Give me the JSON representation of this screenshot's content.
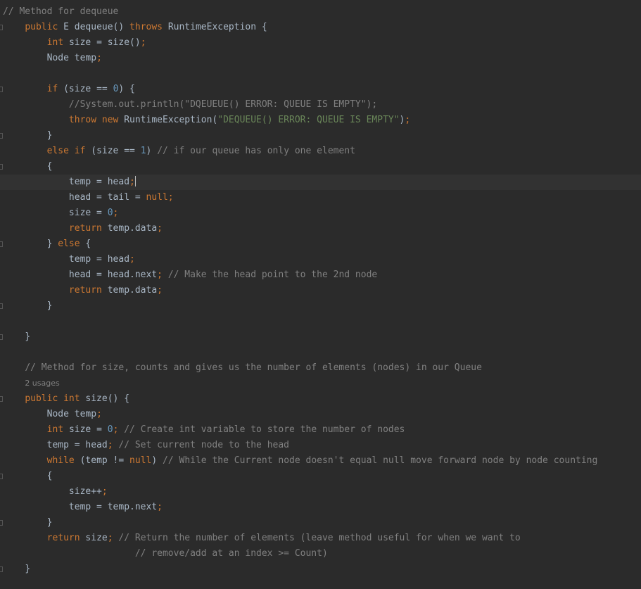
{
  "lines": [
    {
      "fold": false,
      "indent": "",
      "tokens": [
        [
          "cm",
          "// Method for dequeue"
        ]
      ]
    },
    {
      "fold": true,
      "indent": "    ",
      "tokens": [
        [
          "kw",
          "public "
        ],
        [
          "pl",
          "E dequeue() "
        ],
        [
          "kw",
          "throws "
        ],
        [
          "pl",
          "RuntimeException {"
        ]
      ]
    },
    {
      "fold": false,
      "indent": "        ",
      "tokens": [
        [
          "kw",
          "int "
        ],
        [
          "pl",
          "size = size()"
        ],
        [
          "kw",
          ";"
        ]
      ]
    },
    {
      "fold": false,
      "indent": "        ",
      "tokens": [
        [
          "pl",
          "Node temp"
        ],
        [
          "kw",
          ";"
        ]
      ]
    },
    {
      "fold": false,
      "indent": "",
      "tokens": []
    },
    {
      "fold": true,
      "indent": "        ",
      "tokens": [
        [
          "kw",
          "if "
        ],
        [
          "pl",
          "(size == "
        ],
        [
          "nm",
          "0"
        ],
        [
          "pl",
          ") {"
        ]
      ]
    },
    {
      "fold": false,
      "indent": "            ",
      "tokens": [
        [
          "cm",
          "//System.out.println(\"DQEUEUE() ERROR: QUEUE IS EMPTY\");"
        ]
      ]
    },
    {
      "fold": false,
      "indent": "            ",
      "tokens": [
        [
          "kw",
          "throw new "
        ],
        [
          "pl",
          "RuntimeException("
        ],
        [
          "st",
          "\"DEQUEUE() ERROR: QUEUE IS EMPTY\""
        ],
        [
          "pl",
          ")"
        ],
        [
          "kw",
          ";"
        ]
      ]
    },
    {
      "fold": true,
      "indent": "        ",
      "tokens": [
        [
          "pl",
          "}"
        ]
      ]
    },
    {
      "fold": false,
      "indent": "        ",
      "tokens": [
        [
          "kw",
          "else if "
        ],
        [
          "pl",
          "(size == "
        ],
        [
          "nm",
          "1"
        ],
        [
          "pl",
          ") "
        ],
        [
          "cm",
          "// if our queue has only one element"
        ]
      ]
    },
    {
      "fold": true,
      "indent": "        ",
      "tokens": [
        [
          "pl",
          "{"
        ]
      ]
    },
    {
      "fold": false,
      "indent": "            ",
      "current": true,
      "caret": true,
      "tokens": [
        [
          "pl",
          "temp = head"
        ],
        [
          "kw",
          ";"
        ]
      ]
    },
    {
      "fold": false,
      "indent": "            ",
      "tokens": [
        [
          "pl",
          "head = tail = "
        ],
        [
          "kw",
          "null;"
        ]
      ]
    },
    {
      "fold": false,
      "indent": "            ",
      "tokens": [
        [
          "pl",
          "size = "
        ],
        [
          "nm",
          "0"
        ],
        [
          "kw",
          ";"
        ]
      ]
    },
    {
      "fold": false,
      "indent": "            ",
      "tokens": [
        [
          "kw",
          "return "
        ],
        [
          "pl",
          "temp.data"
        ],
        [
          "kw",
          ";"
        ]
      ]
    },
    {
      "fold": true,
      "indent": "        ",
      "tokens": [
        [
          "pl",
          "} "
        ],
        [
          "kw",
          "else "
        ],
        [
          "pl",
          "{"
        ]
      ]
    },
    {
      "fold": false,
      "indent": "            ",
      "tokens": [
        [
          "pl",
          "temp = head"
        ],
        [
          "kw",
          ";"
        ]
      ]
    },
    {
      "fold": false,
      "indent": "            ",
      "tokens": [
        [
          "pl",
          "head = head.next"
        ],
        [
          "kw",
          "; "
        ],
        [
          "cm",
          "// Make the head point to the 2nd node"
        ]
      ]
    },
    {
      "fold": false,
      "indent": "            ",
      "tokens": [
        [
          "kw",
          "return "
        ],
        [
          "pl",
          "temp.data"
        ],
        [
          "kw",
          ";"
        ]
      ]
    },
    {
      "fold": true,
      "indent": "        ",
      "tokens": [
        [
          "pl",
          "}"
        ]
      ]
    },
    {
      "fold": false,
      "indent": "",
      "tokens": []
    },
    {
      "fold": true,
      "indent": "    ",
      "tokens": [
        [
          "pl",
          "}"
        ]
      ]
    },
    {
      "fold": false,
      "indent": "",
      "tokens": []
    },
    {
      "fold": false,
      "indent": "    ",
      "tokens": [
        [
          "cm",
          "// Method for size, counts and gives us the number of elements (nodes) in our Queue"
        ]
      ]
    },
    {
      "fold": false,
      "indent": "    ",
      "usage": true,
      "tokens": [
        [
          "us",
          "2 usages"
        ]
      ]
    },
    {
      "fold": true,
      "indent": "    ",
      "tokens": [
        [
          "kw",
          "public int "
        ],
        [
          "pl",
          "size() {"
        ]
      ]
    },
    {
      "fold": false,
      "indent": "        ",
      "tokens": [
        [
          "pl",
          "Node temp"
        ],
        [
          "kw",
          ";"
        ]
      ]
    },
    {
      "fold": false,
      "indent": "        ",
      "tokens": [
        [
          "kw",
          "int "
        ],
        [
          "pl",
          "size = "
        ],
        [
          "nm",
          "0"
        ],
        [
          "kw",
          "; "
        ],
        [
          "cm",
          "// Create int variable to store the number of nodes"
        ]
      ]
    },
    {
      "fold": false,
      "indent": "        ",
      "tokens": [
        [
          "pl",
          "temp = head"
        ],
        [
          "kw",
          "; "
        ],
        [
          "cm",
          "// Set current node to the head"
        ]
      ]
    },
    {
      "fold": false,
      "indent": "        ",
      "tokens": [
        [
          "kw",
          "while "
        ],
        [
          "pl",
          "(temp != "
        ],
        [
          "kw",
          "null"
        ],
        [
          "pl",
          ") "
        ],
        [
          "cm",
          "// While the Current node doesn't equal null move forward node by node counting"
        ]
      ]
    },
    {
      "fold": true,
      "indent": "        ",
      "tokens": [
        [
          "pl",
          "{"
        ]
      ]
    },
    {
      "fold": false,
      "indent": "            ",
      "tokens": [
        [
          "pl",
          "size++"
        ],
        [
          "kw",
          ";"
        ]
      ]
    },
    {
      "fold": false,
      "indent": "            ",
      "tokens": [
        [
          "pl",
          "temp = temp.next"
        ],
        [
          "kw",
          ";"
        ]
      ]
    },
    {
      "fold": true,
      "indent": "        ",
      "tokens": [
        [
          "pl",
          "}"
        ]
      ]
    },
    {
      "fold": false,
      "indent": "        ",
      "tokens": [
        [
          "kw",
          "return "
        ],
        [
          "pl",
          "size"
        ],
        [
          "kw",
          "; "
        ],
        [
          "cm",
          "// Return the number of elements (leave method useful for when we want to"
        ]
      ]
    },
    {
      "fold": false,
      "indent": "                        ",
      "tokens": [
        [
          "cm",
          "// remove/add at an index >= Count)"
        ]
      ]
    },
    {
      "fold": true,
      "indent": "    ",
      "tokens": [
        [
          "pl",
          "}"
        ]
      ]
    }
  ]
}
